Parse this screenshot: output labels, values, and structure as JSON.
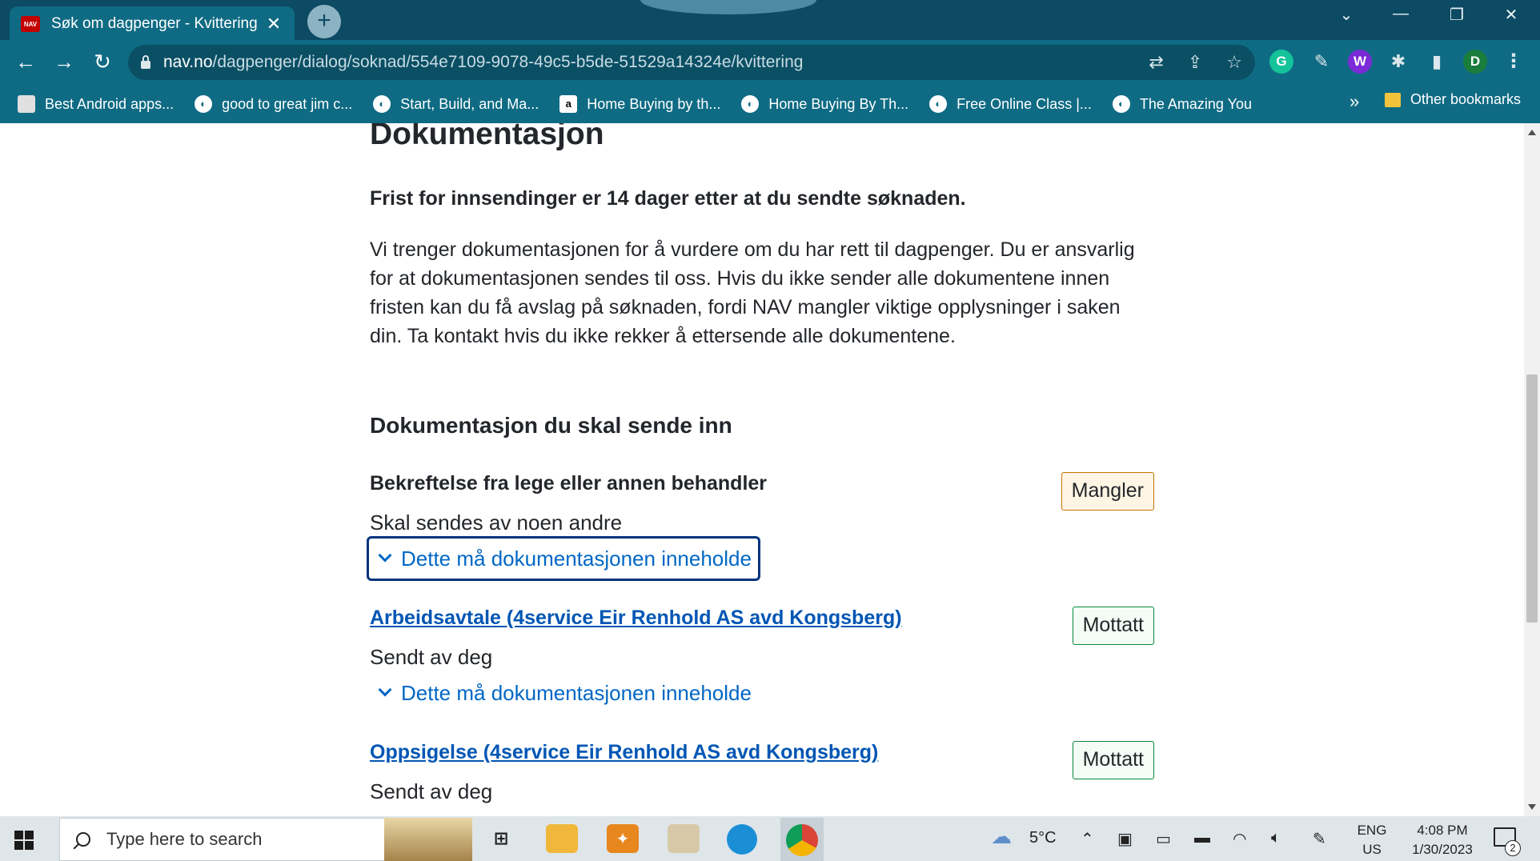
{
  "browser": {
    "tab": {
      "favicon_text": "NAV",
      "title": "Søk om dagpenger - Kvittering",
      "close_glyph": "✕"
    },
    "new_tab_glyph": "+",
    "window_controls": {
      "menu": "⌄",
      "minimize": "—",
      "restore": "❐",
      "close": "✕"
    },
    "nav": {
      "back": "←",
      "forward": "→",
      "reload": "↻"
    },
    "url": {
      "host": "nav.no",
      "path": "/dagpenger/dialog/soknad/554e7109-9078-49c5-b5de-51529a14324e/kvittering"
    },
    "omnibox_icons": [
      "translate-icon",
      "share-icon",
      "star-icon"
    ],
    "extensions": {
      "grammarly": "G",
      "profile": "D",
      "wallet": "W",
      "menu": "⋮"
    },
    "bookmarks": [
      {
        "label": "Best Android apps...",
        "icon": "media-icon"
      },
      {
        "label": "good to great jim c...",
        "icon": "globe-icon"
      },
      {
        "label": "Start, Build, and Ma...",
        "icon": "globe-icon"
      },
      {
        "label": "Home Buying by th...",
        "icon": "amazon-icon",
        "icon_text": "a"
      },
      {
        "label": "Home Buying By Th...",
        "icon": "globe-icon"
      },
      {
        "label": "Free Online Class |...",
        "icon": "globe-icon"
      },
      {
        "label": "The Amazing You",
        "icon": "globe-icon"
      }
    ],
    "bookmarks_more": "»",
    "other_bookmarks": "Other bookmarks"
  },
  "page": {
    "heading": "Dokumentasjon",
    "deadline": "Frist for innsendinger er 14 dager etter at du sendte søknaden.",
    "paragraph_lines": [
      "Vi trenger dokumentasjonen for å vurdere om du har rett til dagpenger. Du er ansvarlig",
      "for at dokumentasjonen sendes til oss. Hvis du ikke sender alle dokumentene innen",
      "fristen kan du få avslag på søknaden, fordi NAV mangler viktige opplysninger i saken",
      "din. Ta kontakt hvis du ikke rekker å ettersende alle dokumentene."
    ],
    "section_heading": "Dokumentasjon du skal sende inn",
    "documents": [
      {
        "title": "Bekreftelse fra lege eller annen behandler",
        "is_link": false,
        "subtitle": "Skal sendes av noen andre",
        "expander": "Dette må dokumentasjonen inneholde",
        "status": "Mangler"
      },
      {
        "title": "Arbeidsavtale (4service Eir Renhold AS avd Kongsberg)",
        "is_link": true,
        "subtitle": "Sendt av deg",
        "expander": "Dette må dokumentasjonen inneholde",
        "status": "Mottatt"
      },
      {
        "title": "Oppsigelse (4service Eir Renhold AS avd Kongsberg)",
        "is_link": true,
        "subtitle": "Sendt av deg",
        "status": "Mottatt"
      }
    ]
  },
  "taskbar": {
    "search_placeholder": "Type here to search",
    "weather": "5°C",
    "language": "ENG",
    "region": "US",
    "time": "4:08 PM",
    "date": "1/30/2023",
    "notifications_count": "2"
  },
  "colors": {
    "chrome_dark": "#0d4a63",
    "chrome": "#0f6b84",
    "link": "#0056b4",
    "action": "#0067c5",
    "warning_bg": "#fff5e4",
    "success_bg": "#f3fcf5"
  }
}
